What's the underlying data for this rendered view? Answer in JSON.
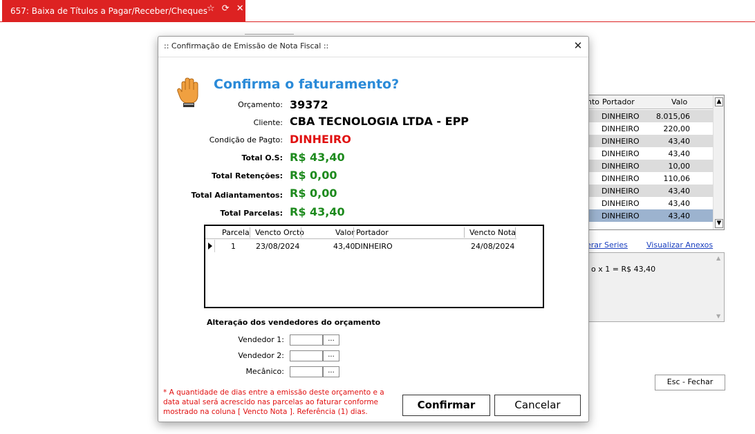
{
  "window": {
    "tab_title": "657: Baixa de Títulos a Pagar/Receber/Cheques",
    "tab_icons": "☆ ⟳ ✕"
  },
  "background": {
    "grid_headers": [
      "nto",
      "Portador",
      "Valo"
    ],
    "grid_rows": [
      {
        "portador": "DINHEIRO",
        "valor": "8.015,06"
      },
      {
        "portador": "DINHEIRO",
        "valor": "220,00"
      },
      {
        "portador": "DINHEIRO",
        "valor": "43,40"
      },
      {
        "portador": "DINHEIRO",
        "valor": "43,40"
      },
      {
        "portador": "DINHEIRO",
        "valor": "10,00"
      },
      {
        "portador": "DINHEIRO",
        "valor": "110,06"
      },
      {
        "portador": "DINHEIRO",
        "valor": "43,40"
      },
      {
        "portador": "DINHEIRO",
        "valor": "43,40"
      },
      {
        "portador": "DINHEIRO",
        "valor": "43,40"
      }
    ],
    "link_series": "erar Series",
    "link_anexos": "Visualizar Anexos",
    "memo_text": "o x 1 = R$ 43,40",
    "esc_button": "Esc - Fechar"
  },
  "dialog": {
    "title": ":: Confirmação de Emissão de Nota Fiscal ::",
    "close_glyph": "✕",
    "question": "Confirma o faturamento?",
    "fields": {
      "orcamento_label": "Orçamento:",
      "orcamento_value": "39372",
      "cliente_label": "Cliente:",
      "cliente_value": "CBA TECNOLOGIA LTDA - EPP",
      "condicao_label": "Condição de Pagto:",
      "condicao_value": "DINHEIRO",
      "total_os_label": "Total O.S:",
      "total_os_value": "R$ 43,40",
      "retencoes_label": "Total Retenções:",
      "retencoes_value": "R$ 0,00",
      "adiantamentos_label": "Total Adiantamentos:",
      "adiantamentos_value": "R$ 0,00",
      "parcelas_label": "Total Parcelas:",
      "parcelas_value": "R$ 43,40"
    },
    "grid": {
      "headers": {
        "parcela": "Parcela",
        "vencto_orcto": "Vencto Orcto",
        "valor": "Valor",
        "portador": "Portador",
        "vencto_nota": "Vencto Nota"
      },
      "rows": [
        {
          "parcela": "1",
          "vencto_orcto": "23/08/2024",
          "valor": "43,40",
          "portador": "DINHEIRO",
          "vencto_nota": "24/08/2024"
        }
      ]
    },
    "vendedores": {
      "section_title": "Alteração dos vendedores do orçamento",
      "vendedor1_label": "Vendedor 1:",
      "vendedor2_label": "Vendedor 2:",
      "mecanico_label": "Mecânico:",
      "lookup_button": "..."
    },
    "note": "* A quantidade de dias entre a emissão deste orçamento e a data atual será acrescido nas parcelas ao faturar conforme mostrado na coluna [ Vencto Nota ]. Referência (1) dias.",
    "confirm_button": "Confirmar",
    "cancel_button": "Cancelar"
  },
  "colors": {
    "tab_red": "#dd2222",
    "question_blue": "#2a8ad8",
    "value_green": "#1d8a1d",
    "value_red": "#e01010",
    "selected_row": "#9cb3cf"
  }
}
